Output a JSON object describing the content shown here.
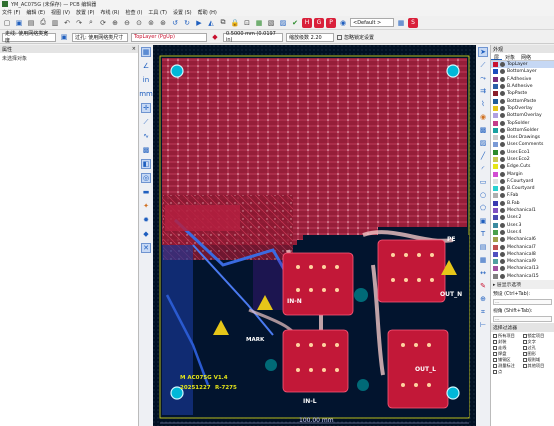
{
  "window": {
    "title": "YM_AC075G (未保存) — PCB 编辑器"
  },
  "menu": [
    "文件 (F)",
    "编辑 (E)",
    "视图 (V)",
    "放置 (P)",
    "布线 (R)",
    "检查 (I)",
    "工具 (T)",
    "设置 (S)",
    "帮助 (H)"
  ],
  "toolbar": {
    "viewport_select": "<Default >"
  },
  "toolbar2": {
    "track_width": "走线: 使用网络类宽度",
    "via_size": "过孔: 使用网络类尺寸",
    "active_layer": "TopLayer (PgUp)",
    "grid": "0.5000 mm (0.0197 in)",
    "zoom": "缩放级数 2.20",
    "lock_label": "忽略锁定设置"
  },
  "left_panel": {
    "title": "属性",
    "content": "未选择对象"
  },
  "board": {
    "line1": "M AC075G V1.4",
    "line2": "20251227",
    "line3": "R-7275",
    "label_in_n": "IN-N",
    "label_in_l": "IN-L",
    "label_out_n": "OUT_N",
    "label_out_l": "OUT_L",
    "label_pe": "PE",
    "label_mark": "MARK",
    "dimension": "100.00 mm"
  },
  "right_panel": {
    "title": "外观",
    "tabs": [
      "层",
      "对象",
      "网络"
    ],
    "layers": [
      {
        "name": "TopLayer",
        "color": "#c8102e"
      },
      {
        "name": "BottomLayer",
        "color": "#1a4dbd"
      },
      {
        "name": "F.Adhesive",
        "color": "#7a2b7a"
      },
      {
        "name": "B.Adhesive",
        "color": "#2b5fa8"
      },
      {
        "name": "TopPaste",
        "color": "#8a1f2a"
      },
      {
        "name": "BottomPaste",
        "color": "#1f5c9a"
      },
      {
        "name": "TopOverlay",
        "color": "#e6c619"
      },
      {
        "name": "BottomOverlay",
        "color": "#b0a0e0"
      },
      {
        "name": "TopSolder",
        "color": "#c43c8a"
      },
      {
        "name": "BottomSolder",
        "color": "#1aa0a0"
      },
      {
        "name": "User.Drawings",
        "color": "#cccccc"
      },
      {
        "name": "User.Comments",
        "color": "#7a9ad6"
      },
      {
        "name": "User.Eco1",
        "color": "#2a8a2a"
      },
      {
        "name": "User.Eco2",
        "color": "#c8c850"
      },
      {
        "name": "Edge.Cuts",
        "color": "#e6e619"
      },
      {
        "name": "Margin",
        "color": "#d24cd2"
      },
      {
        "name": "F.Courtyard",
        "color": "#e0e0e0"
      },
      {
        "name": "B.Courtyard",
        "color": "#2ad0d0"
      },
      {
        "name": "F.Fab",
        "color": "#b0b0b0"
      },
      {
        "name": "B.Fab",
        "color": "#3a3ab0"
      },
      {
        "name": "Mechanical1",
        "color": "#8050c0"
      },
      {
        "name": "User.2",
        "color": "#4a4ab0"
      },
      {
        "name": "User.3",
        "color": "#3a8aa0"
      },
      {
        "name": "User.4",
        "color": "#4aa04a"
      },
      {
        "name": "Mechanical6",
        "color": "#a0a04a"
      },
      {
        "name": "Mechanical7",
        "color": "#c05050"
      },
      {
        "name": "Mechanical8",
        "color": "#5050c0"
      },
      {
        "name": "Mechanical9",
        "color": "#50a0a0"
      },
      {
        "name": "Mechanical13",
        "color": "#a050a0"
      },
      {
        "name": "Mechanical15",
        "color": "#808080"
      }
    ],
    "preset_section": "▸ 层显示选项",
    "preset_label": "预设 (Ctrl+Tab):",
    "preset_value": "---",
    "viewport_label": "视角 (Shift+Tab):",
    "viewport_value": "---",
    "filter_title": "选择过滤器",
    "filters": [
      "所有项目",
      "锁定项目",
      "封装",
      "文字",
      "走线",
      "过孔",
      "焊盘",
      "图形",
      "铺铜区",
      "规则域",
      "测量标注",
      "其他项目",
      "点"
    ]
  }
}
